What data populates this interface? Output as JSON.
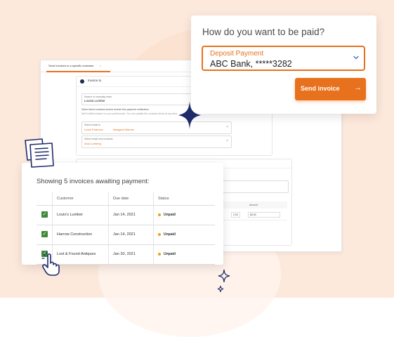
{
  "app": {
    "tab_label": "Send invoices to a specific customer",
    "tab_close": "×",
    "panel_title": "Invoice to",
    "customer_field": {
      "label": "Search or manually enter",
      "value": "Louisa Lumber"
    },
    "note_line1": "Select which contacts should receive this payment notification",
    "note_line2": "We'll notified based on your preferences. You can update the contacts below at any time",
    "email_field": {
      "label": "Select email to",
      "chip1": "Louie Peterson",
      "chip2": "Margaret Barnes"
    },
    "sms_field": {
      "label": "Select email sms contacts",
      "chip1": "Ana Lumberg"
    },
    "lower_table": {
      "col_amount": "Amount",
      "cell_a": "0.00",
      "cell_b": "$0.00"
    }
  },
  "payment": {
    "question": "How do you want to be paid?",
    "method_label": "Deposit Payment",
    "method_value": "ABC Bank, *****3282",
    "send_label": "Send invoice",
    "send_arrow": "→",
    "chevron": "⌄"
  },
  "invoices": {
    "title": "Showing 5 invoices awaiting payment:",
    "headers": [
      "Customer",
      "Due date",
      "Status"
    ],
    "rows": [
      {
        "customer": "Louis's Lumber",
        "due": "Jan 14, 2021",
        "status": "Unpaid"
      },
      {
        "customer": "Harrow Construction",
        "due": "Jan 14, 2021",
        "status": "Unpaid"
      },
      {
        "customer": "Lost & Found Antiques",
        "due": "Jan 30, 2021",
        "status": "Unpaid"
      }
    ],
    "check_glyph": "✓"
  },
  "colors": {
    "accent": "#e8711d",
    "navy": "#1f2a44",
    "check_green": "#3f8a3a",
    "status_dot": "#e8a21d",
    "background": "#fde9dc"
  },
  "icons": {
    "sparkle": "sparkle-icon",
    "documents": "documents-icon",
    "pointer": "pointer-hand-icon",
    "chevron": "chevron-down-icon",
    "arrow": "arrow-right-icon"
  }
}
